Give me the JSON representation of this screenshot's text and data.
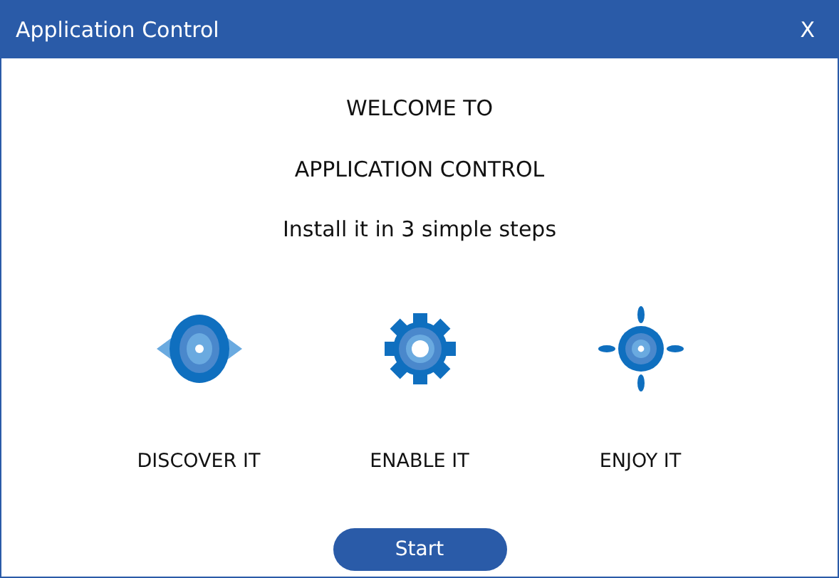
{
  "window": {
    "title": "Application Control",
    "close": "X"
  },
  "heading": [
    "WELCOME TO",
    "APPLICATION CONTROL"
  ],
  "subtitle": "Install it in 3 simple steps",
  "steps": [
    {
      "kind": "eye",
      "label": "DISCOVER IT"
    },
    {
      "kind": "gear",
      "label": "ENABLE IT"
    },
    {
      "kind": "target",
      "label": "ENJOY IT"
    }
  ],
  "button": "Start"
}
